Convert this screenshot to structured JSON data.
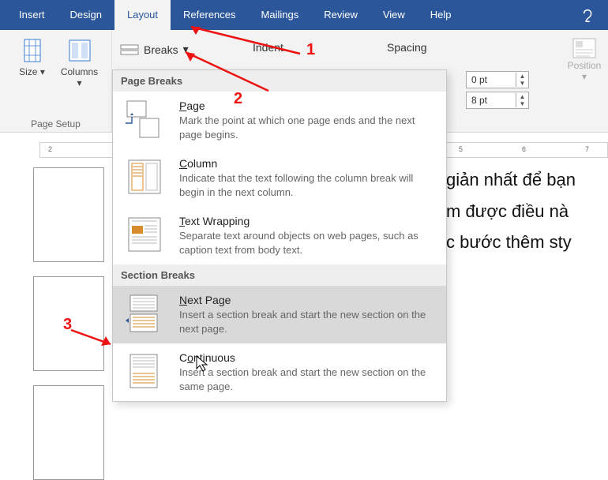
{
  "tabs": {
    "insert": "Insert",
    "design": "Design",
    "layout": "Layout",
    "references": "References",
    "mailings": "Mailings",
    "review": "Review",
    "view": "View",
    "help": "Help"
  },
  "ribbon": {
    "size": "Size",
    "columns": "Columns",
    "pagesetup": "Page Setup",
    "breaks": "Breaks",
    "indent": "Indent",
    "spacing": "Spacing",
    "sp_before": "0 pt",
    "sp_after": "8 pt",
    "position": "Position"
  },
  "menu": {
    "page_breaks_hdr": "Page Breaks",
    "section_breaks_hdr": "Section Breaks",
    "page": {
      "title": "Page",
      "desc": "Mark the point at which one page ends and the next page begins."
    },
    "column": {
      "title": "Column",
      "desc": "Indicate that the text following the column break will begin in the next column."
    },
    "textwrap": {
      "title": "Text Wrapping",
      "desc": "Separate text around objects on web pages, such as caption text from body text."
    },
    "nextpage": {
      "title": "Next Page",
      "desc": "Insert a section break and start the new section on the next page."
    },
    "continuous": {
      "title": "Continuous",
      "desc": "Insert a section break and start the new section on the same page."
    }
  },
  "doc": {
    "line1": "giản nhất để bạn",
    "line2": "m được điều nà",
    "line3": "c bước thêm sty"
  },
  "ruler": {
    "mark2": "2",
    "mark5": "5",
    "mark6": "6",
    "mark7": "7"
  },
  "annotations": {
    "n1": "1",
    "n2": "2",
    "n3": "3"
  }
}
